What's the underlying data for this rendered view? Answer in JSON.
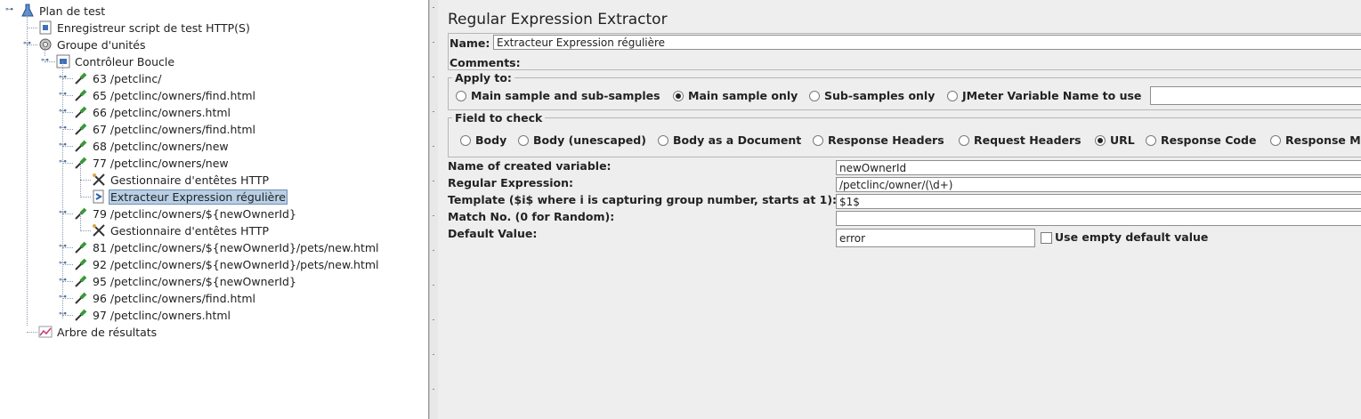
{
  "tree": {
    "items": [
      {
        "label": "Plan de test"
      },
      {
        "label": "Enregistreur script de test HTTP(S)"
      },
      {
        "label": "Groupe d'unités"
      },
      {
        "label": "Contrôleur Boucle"
      },
      {
        "label": "63 /petclinc/"
      },
      {
        "label": "65 /petclinc/owners/find.html"
      },
      {
        "label": "66 /petclinc/owners.html"
      },
      {
        "label": "67 /petclinc/owners/find.html"
      },
      {
        "label": "68 /petclinc/owners/new"
      },
      {
        "label": "77 /petclinc/owners/new"
      },
      {
        "label": "Gestionnaire d'entêtes HTTP"
      },
      {
        "label": "Extracteur Expression régulière"
      },
      {
        "label": "79 /petclinc/owners/${newOwnerId}"
      },
      {
        "label": "Gestionnaire d'entêtes HTTP"
      },
      {
        "label": "81 /petclinc/owners/${newOwnerId}/pets/new.html"
      },
      {
        "label": "92 /petclinc/owners/${newOwnerId}/pets/new.html"
      },
      {
        "label": "95 /petclinc/owners/${newOwnerId}"
      },
      {
        "label": "96 /petclinc/owners/find.html"
      },
      {
        "label": "97 /petclinc/owners.html"
      },
      {
        "label": "Arbre de résultats"
      }
    ]
  },
  "panel": {
    "title": "Regular Expression Extractor",
    "name_label": "Name:",
    "name_value": "Extracteur Expression régulière",
    "comments_label": "Comments:",
    "apply_to": {
      "legend": "Apply to:",
      "options": [
        "Main sample and sub-samples",
        "Main sample only",
        "Sub-samples only",
        "JMeter Variable Name to use"
      ],
      "selected": "Main sample only",
      "variable_value": ""
    },
    "field_to_check": {
      "legend": "Field to check",
      "options": [
        "Body",
        "Body (unescaped)",
        "Body as a Document",
        "Response Headers",
        "Request Headers",
        "URL",
        "Response Code",
        "Response M"
      ],
      "selected": "URL"
    },
    "ref_name_label": "Name of created variable:",
    "ref_name_value": "newOwnerId",
    "regex_label": "Regular Expression:",
    "regex_value": "/petclinc/owner/(\\d+)",
    "template_label": "Template ($i$ where i is capturing group number, starts at 1):",
    "template_value": "$1$",
    "match_label": "Match No. (0 for Random):",
    "match_value": "",
    "default_label": "Default Value:",
    "default_value": "error",
    "empty_default_label": "Use empty default value",
    "empty_default_checked": false
  },
  "icon_names": [
    "test-plan-icon",
    "recorder-icon",
    "thread-group-icon",
    "loop-controller-icon",
    "sampler-pipette-icon",
    "header-manager-icon",
    "regex-extractor-icon",
    "result-tree-icon"
  ]
}
